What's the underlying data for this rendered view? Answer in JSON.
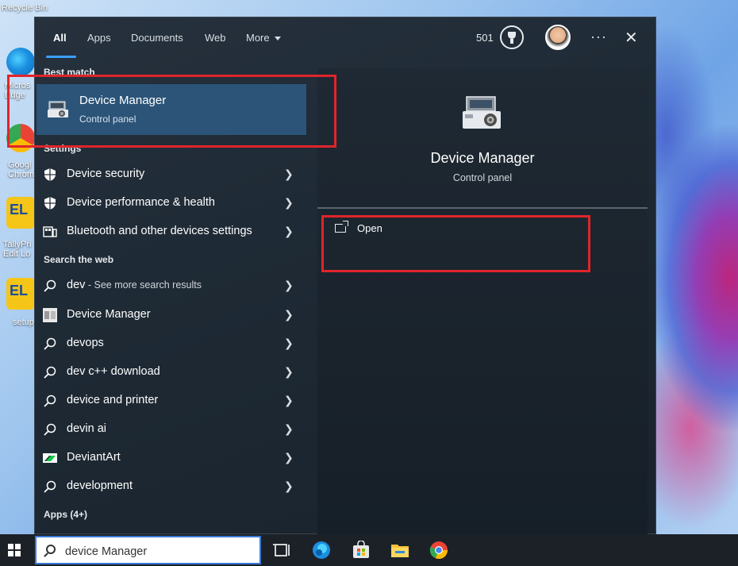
{
  "desktop": {
    "icons": [
      {
        "name": "recycle-bin",
        "label": "Recycle Bin"
      },
      {
        "name": "microsoft-edge",
        "label": "Microsoft Edge"
      },
      {
        "name": "google-chrome",
        "label": "Google Chrome"
      },
      {
        "name": "tallyprime",
        "label": "TallyPrime Edit Log"
      },
      {
        "name": "setup",
        "label": "setup"
      }
    ]
  },
  "start": {
    "tabs": [
      {
        "label": "All",
        "active": true
      },
      {
        "label": "Apps"
      },
      {
        "label": "Documents"
      },
      {
        "label": "Web"
      },
      {
        "label": "More"
      }
    ],
    "points": "501",
    "more_icon": "···",
    "close_icon": "✕",
    "best_match_heading": "Best match",
    "best_match": {
      "title": "Device Manager",
      "subtitle": "Control panel"
    },
    "settings_heading": "Settings",
    "settings_items": [
      {
        "label": "Device security",
        "icon": "shield-icon"
      },
      {
        "label": "Device performance & health",
        "icon": "shield-icon"
      },
      {
        "label": "Bluetooth and other devices settings",
        "icon": "devices-icon"
      }
    ],
    "web_heading": "Search the web",
    "web_items": [
      {
        "label": "dev",
        "sub": " - See more search results",
        "icon": "search-icon"
      },
      {
        "label": "Device Manager",
        "icon": "device-manager-icon"
      },
      {
        "label": "devops",
        "icon": "search-icon"
      },
      {
        "label": "dev c++ download",
        "icon": "search-icon"
      },
      {
        "label": "device and printer",
        "icon": "search-icon"
      },
      {
        "label": "devin ai",
        "icon": "search-icon"
      },
      {
        "label": "DeviantArt",
        "icon": "deviantart-icon"
      },
      {
        "label": "development",
        "icon": "search-icon"
      }
    ],
    "apps_heading": "Apps (4+)",
    "preview": {
      "title": "Device Manager",
      "subtitle": "Control panel",
      "action_open": "Open"
    }
  },
  "taskbar": {
    "search_value": "device Manager",
    "apps": [
      "task-view-icon",
      "edge-icon",
      "store-icon",
      "file-explorer-icon",
      "chrome-icon"
    ]
  },
  "colors": {
    "accent": "#3aa0ff",
    "highlight": "#2b5478",
    "annotation": "#e0252b"
  }
}
